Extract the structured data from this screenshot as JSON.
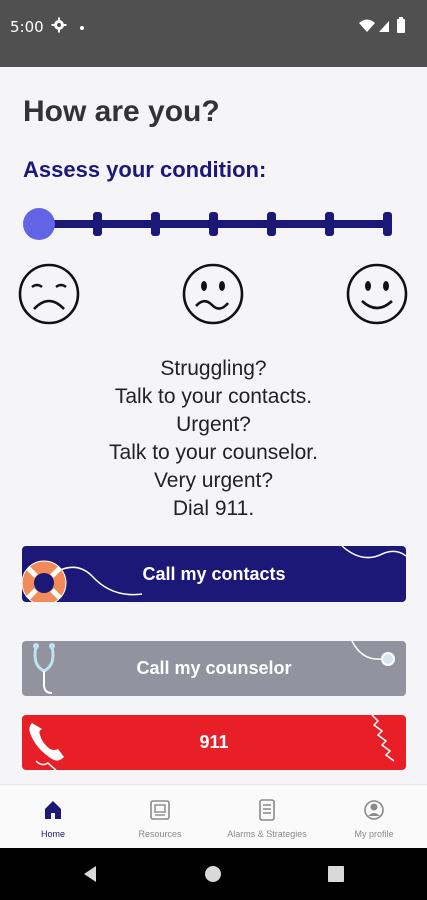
{
  "status_bar": {
    "time": "5:00"
  },
  "header": {
    "title": "How are you?",
    "subtitle": "Assess your condition:"
  },
  "slider": {
    "steps": 7,
    "selected_step": 1,
    "accent_color": "#6164e4",
    "track_color": "#1c1877"
  },
  "emojis": [
    {
      "name": "sad-face-icon"
    },
    {
      "name": "worried-face-icon"
    },
    {
      "name": "happy-face-icon"
    }
  ],
  "guidance": {
    "lines": [
      "Struggling?",
      "Talk to your contacts.",
      "Urgent?",
      "Talk to your counselor.",
      "Very urgent?",
      "Dial 911."
    ]
  },
  "actions": {
    "contacts_label": "Call my contacts",
    "counselor_label": "Call my counselor",
    "emergency_label": "911"
  },
  "bottom_nav": {
    "items": [
      {
        "label": "Home",
        "icon": "home-icon",
        "active": true
      },
      {
        "label": "Resources",
        "icon": "resources-icon",
        "active": false
      },
      {
        "label": "Alarms & Strategies",
        "icon": "alarms-strategies-icon",
        "active": false
      },
      {
        "label": "My profile",
        "icon": "profile-icon",
        "active": false
      }
    ]
  },
  "colors": {
    "primary": "#1c1877",
    "counselor": "#93939f",
    "emergency": "#e81f26"
  }
}
